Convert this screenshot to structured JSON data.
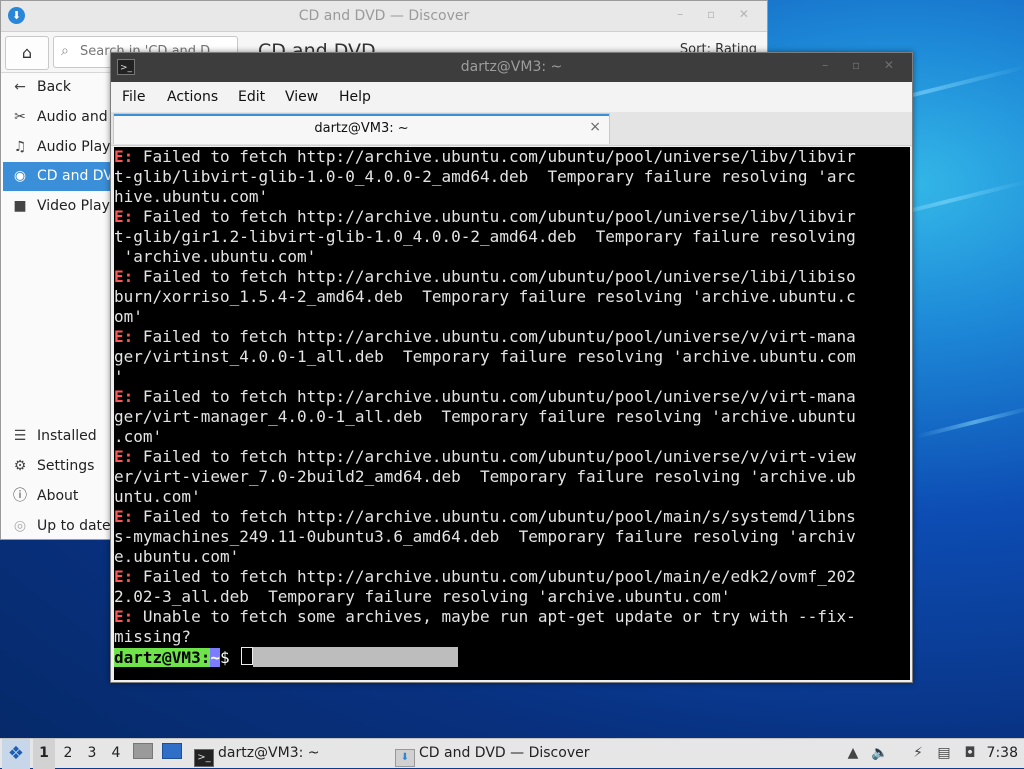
{
  "discover": {
    "title": "CD and DVD — Discover",
    "search_placeholder": "Search in 'CD and D",
    "page_heading": "CD and DVD",
    "sort_label": "Sort: Rating",
    "nav": [
      {
        "label": "Back",
        "icon": "arrow-left-icon"
      },
      {
        "label": "Audio and Video",
        "icon": "scissors-icon"
      },
      {
        "label": "Audio Players",
        "icon": "headphones-icon"
      },
      {
        "label": "CD and DVD",
        "icon": "disc-icon",
        "active": true
      },
      {
        "label": "Video Players",
        "icon": "video-camera-icon"
      }
    ],
    "bottom_nav": [
      {
        "label": "Installed",
        "icon": "list-icon"
      },
      {
        "label": "Settings",
        "icon": "gear-icon"
      },
      {
        "label": "About",
        "icon": "info-icon"
      },
      {
        "label": "Up to date",
        "icon": "update-icon"
      }
    ]
  },
  "terminal": {
    "title": "dartz@VM3: ~",
    "menu": [
      "File",
      "Actions",
      "Edit",
      "View",
      "Help"
    ],
    "tab_label": "dartz@VM3: ~",
    "tab_close": "×",
    "lines": [
      {
        "tag": "E:",
        "text": " Failed to fetch http://archive.ubuntu.com/ubuntu/pool/universe/libv/libvir"
      },
      {
        "tag": "",
        "text": "t-glib/libvirt-glib-1.0-0_4.0.0-2_amd64.deb  Temporary failure resolving 'arc"
      },
      {
        "tag": "",
        "text": "hive.ubuntu.com'"
      },
      {
        "tag": "E:",
        "text": " Failed to fetch http://archive.ubuntu.com/ubuntu/pool/universe/libv/libvir"
      },
      {
        "tag": "",
        "text": "t-glib/gir1.2-libvirt-glib-1.0_4.0.0-2_amd64.deb  Temporary failure resolving"
      },
      {
        "tag": "",
        "text": " 'archive.ubuntu.com'"
      },
      {
        "tag": "E:",
        "text": " Failed to fetch http://archive.ubuntu.com/ubuntu/pool/universe/libi/libiso"
      },
      {
        "tag": "",
        "text": "burn/xorriso_1.5.4-2_amd64.deb  Temporary failure resolving 'archive.ubuntu.c"
      },
      {
        "tag": "",
        "text": "om'"
      },
      {
        "tag": "E:",
        "text": " Failed to fetch http://archive.ubuntu.com/ubuntu/pool/universe/v/virt-mana"
      },
      {
        "tag": "",
        "text": "ger/virtinst_4.0.0-1_all.deb  Temporary failure resolving 'archive.ubuntu.com"
      },
      {
        "tag": "",
        "text": "'"
      },
      {
        "tag": "E:",
        "text": " Failed to fetch http://archive.ubuntu.com/ubuntu/pool/universe/v/virt-mana"
      },
      {
        "tag": "",
        "text": "ger/virt-manager_4.0.0-1_all.deb  Temporary failure resolving 'archive.ubuntu"
      },
      {
        "tag": "",
        "text": ".com'"
      },
      {
        "tag": "E:",
        "text": " Failed to fetch http://archive.ubuntu.com/ubuntu/pool/universe/v/virt-view"
      },
      {
        "tag": "",
        "text": "er/virt-viewer_7.0-2build2_amd64.deb  Temporary failure resolving 'archive.ub"
      },
      {
        "tag": "",
        "text": "untu.com'"
      },
      {
        "tag": "E:",
        "text": " Failed to fetch http://archive.ubuntu.com/ubuntu/pool/main/s/systemd/libns"
      },
      {
        "tag": "",
        "text": "s-mymachines_249.11-0ubuntu3.6_amd64.deb  Temporary failure resolving 'archiv"
      },
      {
        "tag": "",
        "text": "e.ubuntu.com'"
      },
      {
        "tag": "E:",
        "text": " Failed to fetch http://archive.ubuntu.com/ubuntu/pool/main/e/edk2/ovmf_202"
      },
      {
        "tag": "",
        "text": "2.02-3_all.deb  Temporary failure resolving 'archive.ubuntu.com'"
      },
      {
        "tag": "E:",
        "text": " Unable to fetch some archives, maybe run apt-get update or try with --fix-"
      },
      {
        "tag": "",
        "text": "missing?"
      }
    ],
    "prompt": {
      "user": "dartz@VM3",
      "sep": ":",
      "path": "~",
      "symbol": "$ "
    }
  },
  "taskbar": {
    "workspaces": [
      "1",
      "2",
      "3",
      "4"
    ],
    "active_workspace": "1",
    "tasks": [
      {
        "label": "dartz@VM3: ~",
        "icon": "terminal-icon"
      },
      {
        "label": "CD and DVD — Discover",
        "icon": "discover-icon"
      }
    ],
    "clock": "7:38"
  }
}
